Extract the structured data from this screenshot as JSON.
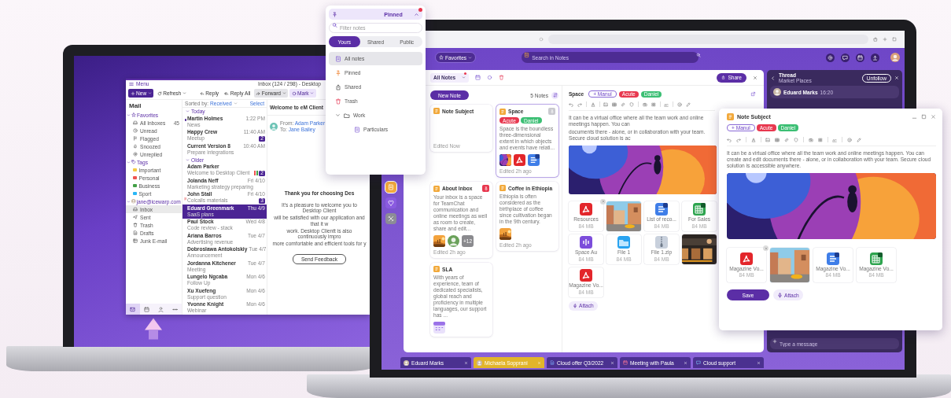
{
  "mail_window": {
    "menu": "Menu",
    "title": "Inbox (124 / 298) - Desktop",
    "toolbar": [
      {
        "label": "New",
        "kind": "primary"
      },
      {
        "label": "Refresh",
        "kind": "menu"
      },
      {
        "label": "Reply",
        "kind": "reply"
      },
      {
        "label": "Reply All",
        "kind": "reply_all"
      },
      {
        "label": "Forward",
        "kind": "forward"
      },
      {
        "label": "Mark",
        "kind": "mark"
      }
    ],
    "sidebar": {
      "title": "Mail",
      "sections": [
        {
          "label": "Favorites",
          "kind": "favorites",
          "expanded": true,
          "items": [
            {
              "label": "All Inboxes",
              "kind": "inbox",
              "count": "45",
              "selected": false
            },
            {
              "label": "Unread",
              "kind": "unread",
              "selected": false
            },
            {
              "label": "Flagged",
              "kind": "flag",
              "selected": false
            },
            {
              "label": "Snoozed",
              "kind": "snooze",
              "selected": false
            },
            {
              "label": "Unreplied",
              "kind": "unreplied",
              "selected": false
            }
          ]
        },
        {
          "label": "Tags",
          "kind": "tags",
          "expanded": true,
          "items": [
            {
              "label": "Important",
              "kind": "tag",
              "color": "#f6c944",
              "selected": false
            },
            {
              "label": "Personal",
              "kind": "tag",
              "color": "#ef5350",
              "selected": false
            },
            {
              "label": "Business",
              "kind": "tag",
              "color": "#43a047",
              "selected": false
            },
            {
              "label": "Sport",
              "kind": "tag",
              "color": "#29b6f6",
              "selected": false
            }
          ]
        },
        {
          "label": "jane@icewarp.com",
          "kind": "account",
          "expanded": true,
          "items": [
            {
              "label": "Inbox",
              "kind": "inbox",
              "selected": true
            },
            {
              "label": "Sent",
              "kind": "sent",
              "selected": false
            },
            {
              "label": "Trash",
              "kind": "trash",
              "selected": false
            },
            {
              "label": "Drafts",
              "kind": "drafts",
              "selected": false
            },
            {
              "label": "Junk E-mail",
              "kind": "junk",
              "selected": false
            }
          ]
        }
      ]
    },
    "bottom_nav": [
      {
        "kind": "mail",
        "selected": true
      },
      {
        "kind": "calendar",
        "selected": false
      },
      {
        "kind": "contacts",
        "selected": false
      },
      {
        "kind": "more",
        "selected": false
      }
    ],
    "message_list": {
      "sort_label": "Sorted by:",
      "sort_value": "Received",
      "select": "Select",
      "groups": [
        {
          "label": "Today",
          "expanded": true,
          "messages": [
            {
              "sender": "Martin Holmes",
              "subject": "News",
              "time": "1:22 PM",
              "unread": true,
              "flagged": false,
              "selected": false
            },
            {
              "sender": "Happy Crew",
              "subject": "Meetup",
              "time": "11:40 AM",
              "badge": "2",
              "unread": false,
              "flagged": false,
              "selected": false
            },
            {
              "sender": "Current Version 8",
              "subject": "Prepare integrations",
              "time": "10:40 AM",
              "unread": false,
              "flagged": false,
              "selected": false
            }
          ]
        },
        {
          "label": "Older",
          "expanded": true,
          "messages": [
            {
              "sender": "Adam Parker",
              "subject": "Welcome to Desktop Client",
              "badge": "2",
              "tags": [
                {
                  "color": "#ef5350"
                },
                {
                  "color": "#43a047"
                }
              ],
              "unread": false,
              "flagged": false,
              "selected": false
            },
            {
              "sender": "Jolanda Neff",
              "subject": "Marketing strategy preparing",
              "time": "Fri 4/10",
              "unread": false,
              "flagged": false,
              "selected": false
            },
            {
              "sender": "John Stall",
              "subject": "Colcalls materials",
              "time": "Fri 4/10",
              "badge": "3",
              "unread": false,
              "flagged": true,
              "selected": false
            },
            {
              "sender": "Eduard Greenmark",
              "subject": "SaaS plans",
              "time": "Thu 4/9",
              "unread": false,
              "flagged": false,
              "selected": true
            },
            {
              "sender": "Paul Stock",
              "subject": "Code review - stack",
              "time": "Wed 4/8",
              "unread": false,
              "flagged": false,
              "selected": false
            },
            {
              "sender": "Ariana Barros",
              "subject": "Advertising revenue",
              "time": "Tue 4/7",
              "unread": false,
              "flagged": false,
              "selected": false
            },
            {
              "sender": "Dobroslawa Antokolskiy",
              "subject": "Announcement",
              "time": "Tue 4/7",
              "unread": false,
              "flagged": false,
              "selected": false
            },
            {
              "sender": "Jordanna Kitchener",
              "subject": "Meeting",
              "time": "Tue 4/7",
              "unread": false,
              "flagged": false,
              "selected": false
            },
            {
              "sender": "Lungelo Ngcaba",
              "subject": "Follow Up",
              "time": "Mon 4/6",
              "unread": false,
              "flagged": false,
              "selected": false
            },
            {
              "sender": "Xu Xuefeng",
              "subject": "Support question",
              "time": "Mon 4/6",
              "unread": false,
              "flagged": false,
              "selected": false
            },
            {
              "sender": "Yvonne Knight",
              "subject": "Webinar",
              "time": "Mon 4/6",
              "unread": false,
              "flagged": false,
              "selected": false
            }
          ]
        }
      ]
    },
    "reader": {
      "title": "Welcome to eM Client",
      "from_label": "From:",
      "from": "Adam Parker",
      "to_label": "To:",
      "to": "Jane Bailey",
      "heading": "Thank you for choosing Des",
      "body": [
        "It's a pleasure to welcome you to Desktop Client",
        "will be satisfied with our application and that it w",
        "work. Desktop Clientt is also continuously impro",
        "more comfortable and efficient tools for y"
      ],
      "button": "Send Feedback"
    }
  },
  "pinned_popup": {
    "title": "Pinned",
    "filter_placeholder": "Filter notes",
    "tabs": [
      {
        "label": "Yours",
        "selected": true
      },
      {
        "label": "Shared",
        "selected": false
      },
      {
        "label": "Public",
        "selected": false
      }
    ],
    "items": [
      {
        "label": "All notes",
        "kind": "note",
        "selected": true
      },
      {
        "label": "Pinned",
        "kind": "pin",
        "selected": false
      },
      {
        "label": "Shared",
        "kind": "shared",
        "selected": false
      },
      {
        "label": "Trash",
        "kind": "trash",
        "selected": false
      },
      {
        "label": "Work",
        "kind": "folder",
        "selected": false,
        "expanded": true,
        "children": [
          {
            "label": "Particulars",
            "kind": "note",
            "selected": false
          }
        ]
      }
    ]
  },
  "notes_app": {
    "favorites": "Favorites",
    "search_placeholder": "Search in Notes",
    "rail": [
      {
        "kind": "notes",
        "selected": true
      },
      {
        "kind": "heart",
        "selected": false
      },
      {
        "kind": "tools",
        "selected": false
      }
    ],
    "toolbar": {
      "folder": "All Notes",
      "share": "Share"
    },
    "list": {
      "new_note": "New Note",
      "count": "5 Notes",
      "cards": [
        {
          "title": "Note Subject",
          "selected": false,
          "footer": "Edited Now"
        },
        {
          "title": "Space",
          "pinned": false,
          "selected": true,
          "tags": [
            {
              "label": "Acute",
              "color": "#e8384f"
            },
            {
              "label": "Daniel",
              "color": "#3cbf74"
            }
          ],
          "preview": "Space is the boundless three-dimensional extent in which objects and events have relati...",
          "attachments": [
            {
              "kind": "picture"
            },
            {
              "kind": "pdf"
            },
            {
              "kind": "doc"
            }
          ],
          "footer": "Edited 2h ago"
        },
        {
          "title": "About Inbox",
          "pinned": true,
          "selected": false,
          "preview": "Your inbox is a space for TeamChat communication and online meetings as well as room to create, share and edit...",
          "attachments": [
            {
              "kind": "picture"
            },
            {
              "kind": "avatar"
            },
            {
              "kind": "more",
              "label": "+12"
            }
          ],
          "footer": "Edited 2h ago"
        },
        {
          "title": "Coffee in Ethiopia",
          "selected": false,
          "preview": "Ethiopia is often considered as the birthplace of coffee since cultivation began in the 9th century.",
          "attachments": [
            {
              "kind": "picture"
            }
          ],
          "footer": "Edited 2h ago"
        },
        {
          "title": "SLA",
          "selected": false,
          "preview": "With years of experience, team of dedicated specialists, global reach and proficiency in multiple languages, our support has ...",
          "attachments": [
            {
              "kind": "calendar"
            }
          ]
        }
      ]
    },
    "editor": {
      "title": "Space",
      "tags": [
        {
          "label": "+ Manul",
          "kind": "add"
        },
        {
          "label": "Acute",
          "kind": "tag",
          "color": "#e8384f"
        },
        {
          "label": "Daniel",
          "kind": "tag",
          "color": "#3cbf74"
        }
      ],
      "body": [
        "It can be a virtual office where all the team work and online meetings happen. You can",
        "documents there - alone, or in collaboration with your team. Secure cloud solution is ac"
      ],
      "attachments": [
        {
          "kind": "pdf",
          "name": "Resources",
          "size": "84 MB",
          "removable": true
        },
        {
          "kind": "picture",
          "removable": false
        },
        {
          "kind": "doc",
          "name": "List of reco...",
          "size": "84 MB",
          "removable": false
        },
        {
          "kind": "sheet",
          "name": "For Sales",
          "size": "84 MB",
          "removable": false
        },
        {
          "kind": "audio",
          "name": "Space Au",
          "size": "84 MB",
          "removable": false
        },
        {
          "kind": "folder",
          "name": "File 1",
          "size": "84 MB",
          "removable": false
        },
        {
          "kind": "zip",
          "name": "File 1.zip",
          "size": "84 MB",
          "removable": false
        },
        {
          "kind": "picture",
          "removable": false
        },
        {
          "kind": "pdf",
          "name": "Magazine Vo...",
          "size": "84 MB",
          "removable": false
        }
      ],
      "attach": "Attach"
    },
    "thread": {
      "title": "Thread",
      "subtitle": "Market Places",
      "follow_button": "Unfollow",
      "author": "Eduard Marks",
      "time": "16:20",
      "input_placeholder": "Type a message"
    },
    "taskbar": [
      {
        "label": "Eduard Marks",
        "kind": "person",
        "selected": false
      },
      {
        "label": "Michaela Sopprani",
        "kind": "person",
        "selected": true
      },
      {
        "label": "Cloud offer Q3/2022",
        "kind": "doc",
        "selected": false
      },
      {
        "label": "Meeting with Paula",
        "kind": "meeting",
        "selected": false
      },
      {
        "label": "Cloud support",
        "kind": "chat",
        "selected": false
      }
    ]
  },
  "note_window": {
    "title": "Note Subject",
    "tags": [
      {
        "label": "+ Manul",
        "kind": "add"
      },
      {
        "label": "Acute",
        "kind": "tag",
        "color": "#e8384f"
      },
      {
        "label": "Daniel",
        "kind": "tag",
        "color": "#3cbf74"
      }
    ],
    "body": "It can be a virtual office where all the team work and online meetings happen. You can create and edit documents there - alone, or in collaboration with your team. Secure cloud solution is accessible anywhere.",
    "attachments": [
      {
        "kind": "pdf",
        "name": "Magazine Vo...",
        "size": "84 MB",
        "removable": true
      },
      {
        "kind": "picture",
        "removable": false
      },
      {
        "kind": "doc",
        "name": "Magazine Vo...",
        "size": "84 MB",
        "removable": false
      },
      {
        "kind": "sheet",
        "name": "Magazine Vo...",
        "size": "84 MB",
        "removable": false
      }
    ],
    "save": "Save",
    "attach": "Attach"
  }
}
